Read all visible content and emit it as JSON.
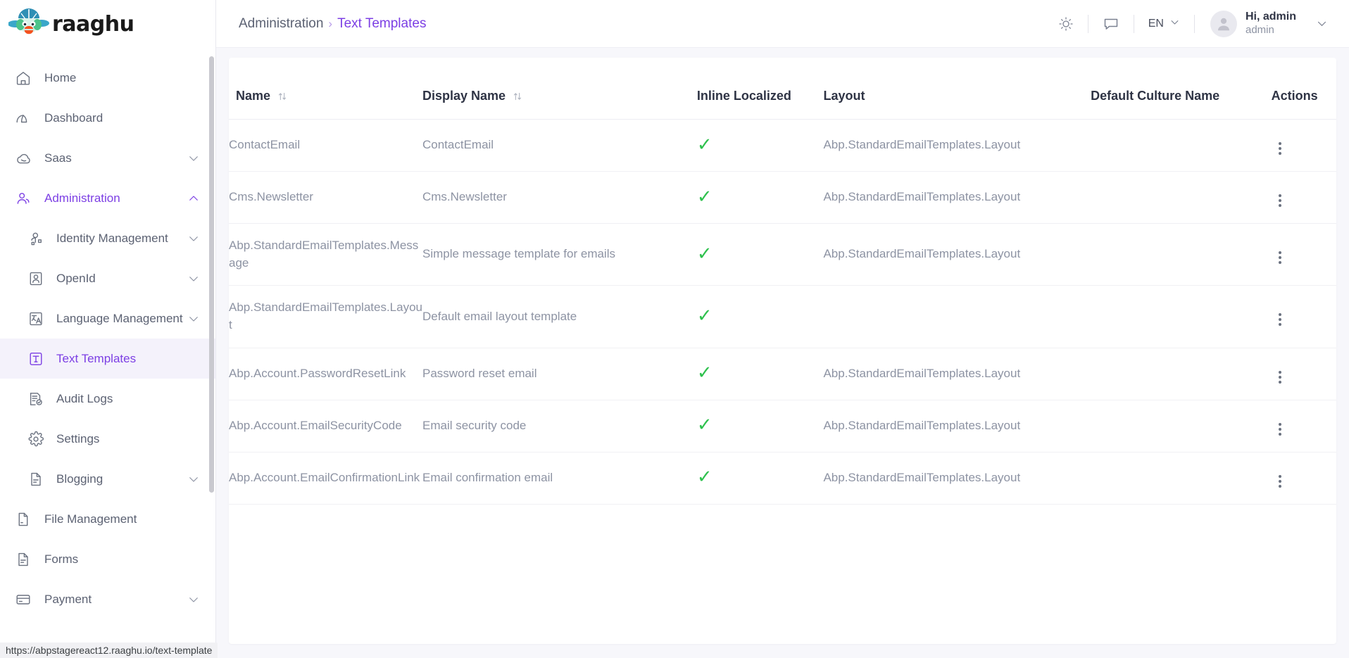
{
  "brand": {
    "name": "raaghu",
    "logo_icon": "raaghu-bird-logo"
  },
  "sidebar": {
    "items": [
      {
        "label": "Home",
        "icon": "home-icon",
        "level": 0,
        "expandable": false,
        "state": "normal"
      },
      {
        "label": "Dashboard",
        "icon": "dashboard-icon",
        "level": 0,
        "expandable": false,
        "state": "normal"
      },
      {
        "label": "Saas",
        "icon": "cloud-icon",
        "level": 0,
        "expandable": true,
        "state": "normal",
        "chevron": "down"
      },
      {
        "label": "Administration",
        "icon": "user-group-icon",
        "level": 0,
        "expandable": true,
        "state": "active-parent",
        "chevron": "up"
      },
      {
        "label": "Identity Management",
        "icon": "identity-icon",
        "level": 1,
        "expandable": true,
        "state": "normal",
        "chevron": "down"
      },
      {
        "label": "OpenId",
        "icon": "openid-badge-icon",
        "level": 1,
        "expandable": true,
        "state": "normal",
        "chevron": "down"
      },
      {
        "label": "Language Management",
        "icon": "translate-icon",
        "level": 1,
        "expandable": true,
        "state": "normal",
        "chevron": "down"
      },
      {
        "label": "Text Templates",
        "icon": "text-template-icon",
        "level": 1,
        "expandable": false,
        "state": "current"
      },
      {
        "label": "Audit Logs",
        "icon": "audit-log-icon",
        "level": 1,
        "expandable": false,
        "state": "normal"
      },
      {
        "label": "Settings",
        "icon": "gear-icon",
        "level": 1,
        "expandable": false,
        "state": "normal"
      },
      {
        "label": "Blogging",
        "icon": "document-icon",
        "level": 1,
        "expandable": true,
        "state": "normal",
        "chevron": "down"
      },
      {
        "label": "File Management",
        "icon": "file-icon",
        "level": 0,
        "expandable": false,
        "state": "normal"
      },
      {
        "label": "Forms",
        "icon": "document-icon",
        "level": 0,
        "expandable": false,
        "state": "normal"
      },
      {
        "label": "Payment",
        "icon": "credit-card-icon",
        "level": 0,
        "expandable": true,
        "state": "normal",
        "chevron": "down"
      }
    ]
  },
  "topbar": {
    "breadcrumb": {
      "root": "Administration",
      "separator": "›",
      "current": "Text Templates"
    },
    "theme_icon": "sun-icon",
    "chat_icon": "chat-bubble-icon",
    "language": {
      "code": "EN",
      "chevron_icon": "chevron-down-icon"
    },
    "user": {
      "avatar_icon": "user-avatar-icon",
      "greeting": "Hi, admin",
      "username": "admin",
      "chevron_icon": "chevron-down-icon"
    }
  },
  "table": {
    "columns": [
      {
        "label": "Name",
        "sortable": true
      },
      {
        "label": "Display Name",
        "sortable": true
      },
      {
        "label": "Inline Localized",
        "sortable": false
      },
      {
        "label": "Layout",
        "sortable": false
      },
      {
        "label": "Default Culture Name",
        "sortable": false
      },
      {
        "label": "Actions",
        "sortable": false
      }
    ],
    "sort_icon": "sort-updown-icon",
    "check_glyph": "✓",
    "row_menu_icon": "kebab-menu-icon",
    "rows": [
      {
        "name": "ContactEmail",
        "display_name": "ContactEmail",
        "inline_localized": true,
        "layout": "Abp.StandardEmailTemplates.Layout",
        "default_culture_name": ""
      },
      {
        "name": "Cms.Newsletter",
        "display_name": "Cms.Newsletter",
        "inline_localized": true,
        "layout": "Abp.StandardEmailTemplates.Layout",
        "default_culture_name": ""
      },
      {
        "name": "Abp.StandardEmailTemplates.Message",
        "display_name": "Simple message template for emails",
        "inline_localized": true,
        "layout": "Abp.StandardEmailTemplates.Layout",
        "default_culture_name": ""
      },
      {
        "name": "Abp.StandardEmailTemplates.Layout",
        "display_name": "Default email layout template",
        "inline_localized": true,
        "layout": "",
        "default_culture_name": ""
      },
      {
        "name": "Abp.Account.PasswordResetLink",
        "display_name": "Password reset email",
        "inline_localized": true,
        "layout": "Abp.StandardEmailTemplates.Layout",
        "default_culture_name": ""
      },
      {
        "name": "Abp.Account.EmailSecurityCode",
        "display_name": "Email security code",
        "inline_localized": true,
        "layout": "Abp.StandardEmailTemplates.Layout",
        "default_culture_name": ""
      },
      {
        "name": "Abp.Account.EmailConfirmationLink",
        "display_name": "Email confirmation email",
        "inline_localized": true,
        "layout": "Abp.StandardEmailTemplates.Layout",
        "default_culture_name": ""
      }
    ]
  },
  "statusbar": {
    "url": "https://abpstagereact12.raaghu.io/text-template"
  },
  "colors": {
    "accent": "#7c3fe4",
    "accent_bg": "#f4f2fb",
    "check_green": "#2fc14e",
    "text_dark": "#2f3445",
    "text_muted": "#8d93a3",
    "page_bg": "#f7f7fb"
  }
}
